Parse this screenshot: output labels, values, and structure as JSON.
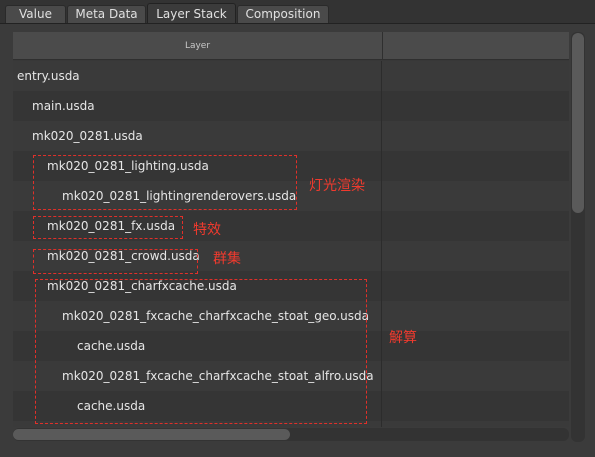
{
  "tabs": [
    {
      "label": "Value",
      "active": false
    },
    {
      "label": "Meta Data",
      "active": false
    },
    {
      "label": "Layer Stack",
      "active": true
    },
    {
      "label": "Composition",
      "active": false
    }
  ],
  "table": {
    "column_header": "Layer",
    "rows": [
      {
        "label": "entry.usda",
        "depth": 0
      },
      {
        "label": "main.usda",
        "depth": 1
      },
      {
        "label": "mk020_0281.usda",
        "depth": 1
      },
      {
        "label": "mk020_0281_lighting.usda",
        "depth": 2
      },
      {
        "label": "mk020_0281_lightingrenderovers.usda",
        "depth": 3
      },
      {
        "label": "mk020_0281_fx.usda",
        "depth": 2
      },
      {
        "label": "mk020_0281_crowd.usda",
        "depth": 2
      },
      {
        "label": "mk020_0281_charfxcache.usda",
        "depth": 2
      },
      {
        "label": "mk020_0281_fxcache_charfxcache_stoat_geo.usda",
        "depth": 3
      },
      {
        "label": "cache.usda",
        "depth": 4
      },
      {
        "label": "mk020_0281_fxcache_charfxcache_stoat_alfro.usda",
        "depth": 3
      },
      {
        "label": "cache.usda",
        "depth": 4
      }
    ]
  },
  "annotations": [
    {
      "label": "灯光渲染"
    },
    {
      "label": "特效"
    },
    {
      "label": "群集"
    },
    {
      "label": "解算"
    }
  ],
  "colors": {
    "annotation": "#e0302a",
    "background": "#3b3b3b",
    "header": "#4b4b4b"
  }
}
